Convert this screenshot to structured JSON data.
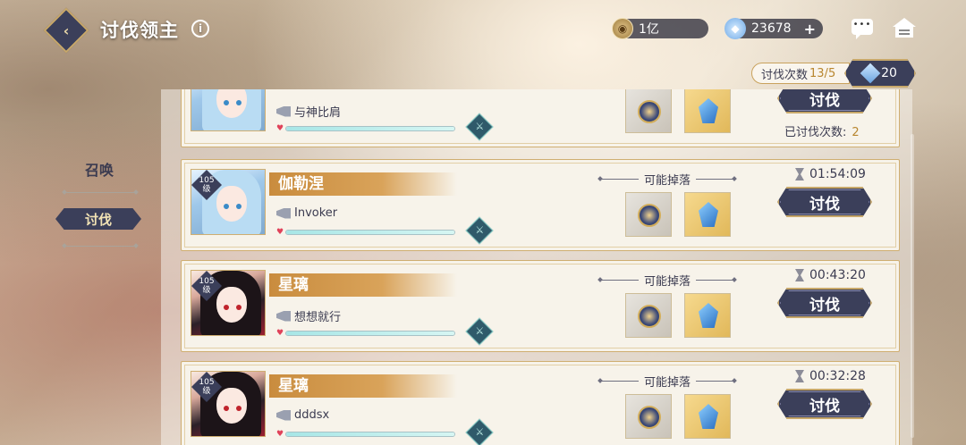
{
  "header": {
    "title": "讨伐领主",
    "info_icon": "i",
    "currencies": [
      {
        "icon": "coin-icon",
        "value": "1亿"
      },
      {
        "icon": "crystal-icon",
        "value": "23678",
        "plus": "+"
      }
    ]
  },
  "attempts": {
    "label": "讨伐次数",
    "count": "13/5",
    "tickets": "20"
  },
  "sidebar": {
    "items": [
      {
        "label": "召唤"
      },
      {
        "label": "讨伐"
      }
    ]
  },
  "list": {
    "drop_label": "可能掉落",
    "raid_button": "讨伐",
    "level_unit": "级",
    "cards": [
      {
        "boss": "",
        "level": "",
        "owner": "与神比肩",
        "hp_fraction": 1.0,
        "timer": "",
        "done_label": "已讨伐次数:",
        "done_value": "2"
      },
      {
        "boss": "伽勒涅",
        "level": "105",
        "owner": "Invoker",
        "hp_fraction": 1.0,
        "timer": "01:54:09"
      },
      {
        "boss": "星璃",
        "level": "105",
        "owner": "想想就行",
        "hp_fraction": 1.0,
        "timer": "00:43:20"
      },
      {
        "boss": "星璃",
        "level": "105",
        "owner": "dddsx",
        "hp_fraction": 1.0,
        "timer": "00:32:28"
      }
    ]
  },
  "colors": {
    "accent_dark": "#3b3f5a",
    "gold": "#c8a86a",
    "name_band": "#c98c3e",
    "count_highlight": "#b8862f"
  }
}
